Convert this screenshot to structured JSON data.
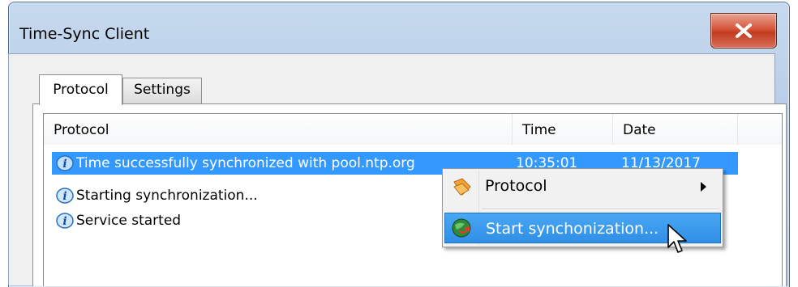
{
  "window": {
    "title": "Time-Sync Client",
    "close_symbol": "x"
  },
  "tabs": [
    {
      "label": "Protocol",
      "active": true
    },
    {
      "label": "Settings",
      "active": false
    }
  ],
  "list": {
    "columns": [
      "Protocol",
      "Time",
      "Date"
    ],
    "rows": [
      {
        "icon": "info-icon",
        "message": "Time successfully synchronized with pool.ntp.org",
        "time": "10:35:01",
        "date": "11/13/2017",
        "selected": true
      },
      {
        "icon": "info-icon",
        "message": "Starting synchronization...",
        "time": "",
        "date": "",
        "selected": false
      },
      {
        "icon": "info-icon",
        "message": "Service started",
        "time": "",
        "date": "",
        "selected": false
      }
    ]
  },
  "context_menu": {
    "items": [
      {
        "label": "Protocol",
        "icon": "protocol-icon",
        "has_submenu": true
      },
      {
        "label": "Start synchonization...",
        "icon": "globe-sync-icon",
        "hovered": true
      }
    ]
  },
  "colors": {
    "selection": "#3399ff",
    "menu_hover": "#3b99ee",
    "close_red": "#c23b20"
  }
}
